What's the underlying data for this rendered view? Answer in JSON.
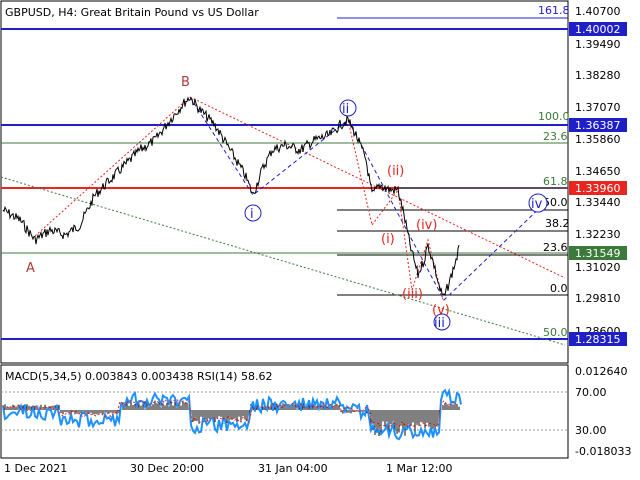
{
  "header": {
    "title": "GBPUSD, H4:  Great Britain Pound vs US Dollar"
  },
  "indicator_header": {
    "text": "MACD(5,34,5) 0.003843 0.003438 RSI(14) 58.62"
  },
  "price_axis": [
    "1.40700",
    "1.39490",
    "1.38280",
    "1.37070",
    "1.35860",
    "1.34650",
    "1.33440",
    "1.32230",
    "1.31020",
    "1.29810",
    "1.28600"
  ],
  "highlight_prices": [
    {
      "value": "1.40002",
      "color": "#1f1fc8"
    },
    {
      "value": "1.36387",
      "color": "#1f1fc8"
    },
    {
      "value": "1.33960",
      "color": "#e6261f"
    },
    {
      "value": "1.31549",
      "color": "#3c7a3c"
    },
    {
      "value": "1.28315",
      "color": "#1f1fc8"
    }
  ],
  "indicator_axis": [
    "0.012640",
    "70.00",
    "30.00",
    "-0.018033"
  ],
  "time_axis": [
    "1 Dec 2021",
    "30 Dec 20:00",
    "31 Jan 04:00",
    "1 Mar 12:00"
  ],
  "fib_upper": [
    {
      "label": "161.8",
      "color": "#1f1fc8"
    },
    {
      "label": "100.0",
      "color": "#3c7a3c"
    },
    {
      "label": "23.6",
      "color": "#3c7a3c"
    }
  ],
  "fib_lower": [
    {
      "label": "61.8",
      "color": "#3c7a3c"
    },
    {
      "label": "50.0",
      "color": "#000"
    },
    {
      "label": "38.2",
      "color": "#000"
    },
    {
      "label": "23.6",
      "color": "#000"
    },
    {
      "label": "0.0",
      "color": "#000"
    },
    {
      "label": "50.0",
      "color": "#3c7a3c"
    }
  ],
  "waves": [
    {
      "label": "A",
      "color": "#b03a3a"
    },
    {
      "label": "B",
      "color": "#b03a3a"
    },
    {
      "label": "i",
      "color": "#1f1fc8"
    },
    {
      "label": "ii",
      "color": "#1f1fc8"
    },
    {
      "label": "(ii)",
      "color": "#e6261f"
    },
    {
      "label": "(i)",
      "color": "#e6261f"
    },
    {
      "label": "(iv)",
      "color": "#e6261f"
    },
    {
      "label": "(iii)",
      "color": "#e6261f"
    },
    {
      "label": "(v)",
      "color": "#e6261f"
    },
    {
      "label": "iii",
      "color": "#1f1fc8"
    },
    {
      "label": "iv",
      "color": "#1f1fc8"
    }
  ],
  "colors": {
    "blue": "#1f1fc8",
    "red": "#e6261f",
    "green": "#3c7a3c",
    "purple": "#7a1f8a",
    "rsi": "#1e90ff"
  }
}
